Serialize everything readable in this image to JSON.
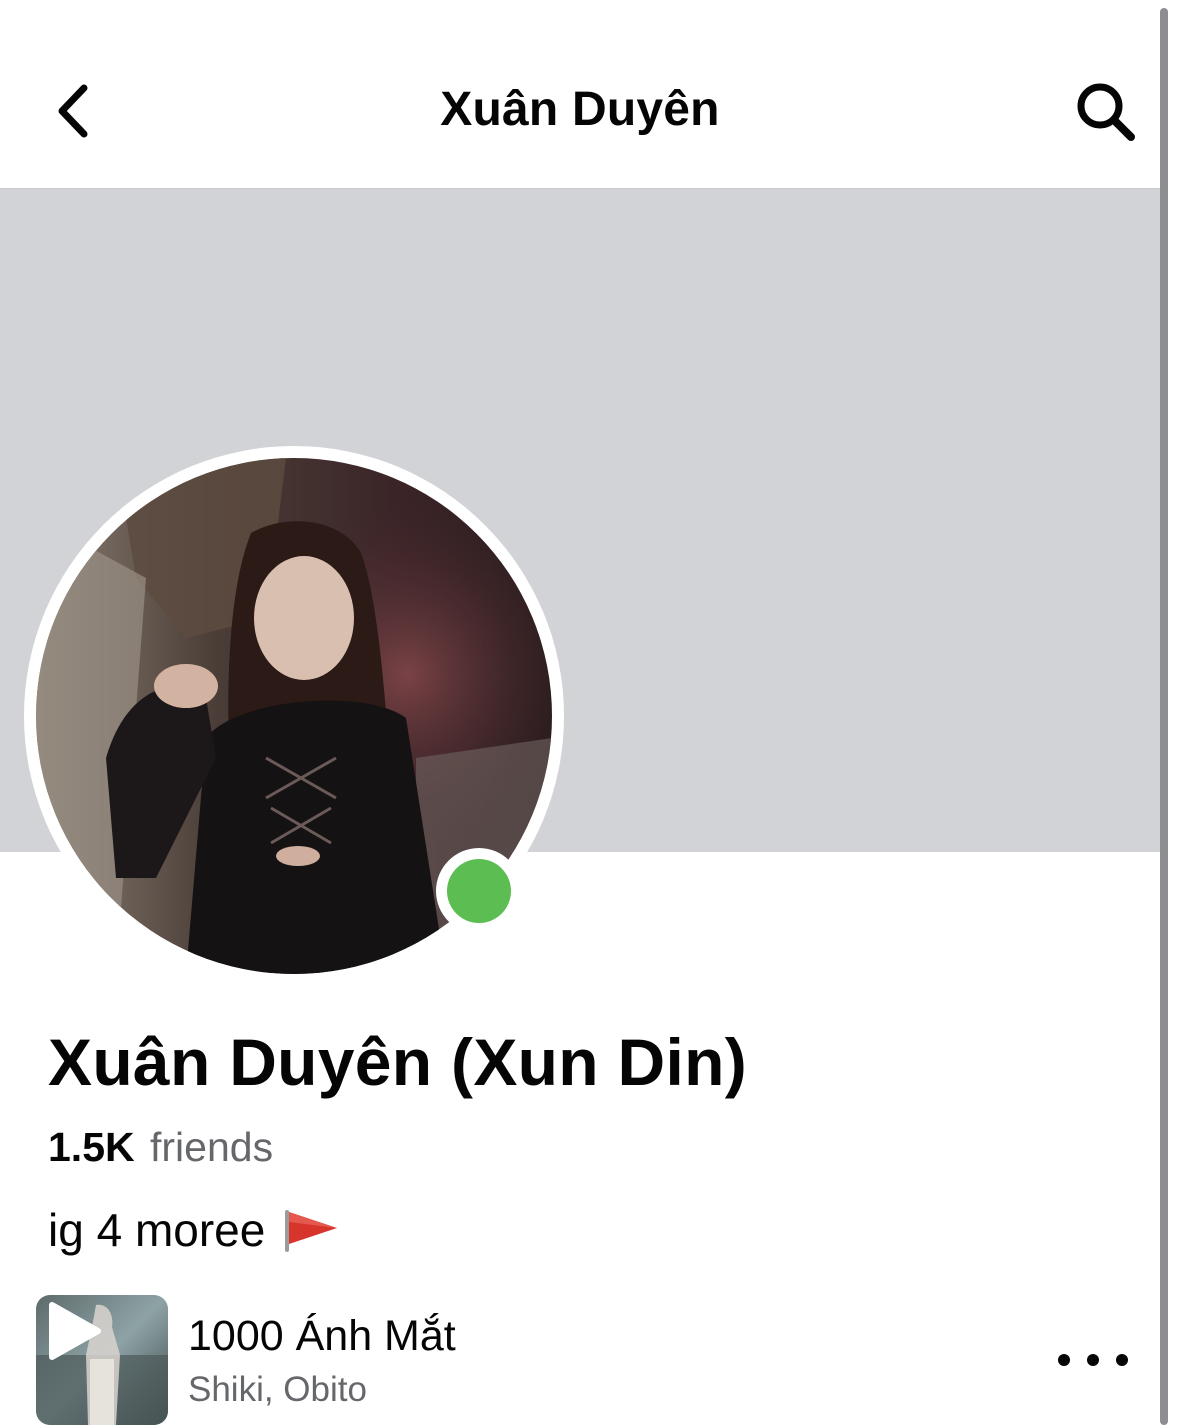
{
  "header": {
    "title": "Xuân Duyên",
    "back_icon": "chevron-left-icon",
    "search_icon": "search-icon"
  },
  "profile": {
    "name": "Xuân Duyên (Xun Din)",
    "friends_count": "1.5K",
    "friends_label": "friends",
    "bio": "ig 4 moree",
    "bio_icon": "red-flag-icon",
    "online_status_color": "#5cbd52"
  },
  "music": {
    "title": "1000 Ánh Mắt",
    "artist": "Shiki, Obito",
    "play_icon": "play-icon",
    "more_icon": "more-horizontal-icon"
  },
  "colors": {
    "cover_background": "#d2d3d7",
    "secondary_text": "#65676b",
    "primary_text": "#050505"
  }
}
